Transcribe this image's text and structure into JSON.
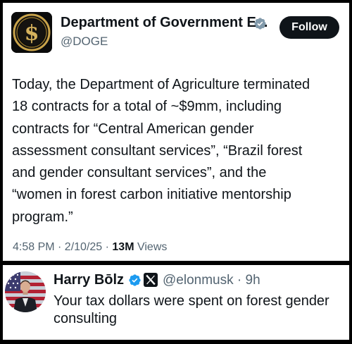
{
  "main_post": {
    "author": {
      "display_name": "Department of Government E...",
      "handle": "@DOGE",
      "verified_badge": "grey-verified-badge",
      "avatar_icon": "dollar-coin-icon"
    },
    "follow_label": "Follow",
    "text": "Today, the Department of Agriculture terminated\n18 contracts for a total of ~$9mm, including\ncontracts for “Central American gender\nassessment consultant services”, “Brazil forest\nand gender consultant services”, and the\n“women in forest carbon initiative mentorship\nprogram.”",
    "timestamp": "4:58 PM · 2/10/25 · ",
    "views_count": "13M",
    "views_label": "Views"
  },
  "reply": {
    "author": {
      "display_name": "Harry Bōlz",
      "handle": "@elonmusk",
      "time_ago": "9h",
      "verified_badge": "blue-verified-badge",
      "affiliate_icon": "x-logo-icon"
    },
    "text": "Your tax dollars were spent on forest gender consulting"
  },
  "colors": {
    "background": "#000000",
    "card": "#ffffff",
    "primary_text": "#0f1419",
    "secondary_text": "#536471",
    "verified_blue": "#1d9bf0",
    "verified_grey": "#829aab",
    "coin_gold": "#c9a34a"
  }
}
